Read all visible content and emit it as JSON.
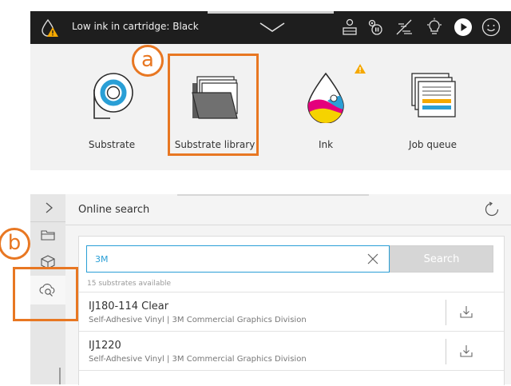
{
  "status_bar": {
    "message": "Low ink in cartridge: Black",
    "icons": [
      "ink-warning-icon",
      "chevron-down-icon",
      "substrate-load-icon",
      "cutter-icon",
      "lamp-icon",
      "light-icon",
      "play-icon",
      "smiley-icon"
    ]
  },
  "tiles": [
    {
      "label": "Substrate",
      "icon": "substrate-roll-icon"
    },
    {
      "label": "Substrate library",
      "icon": "folder-icon"
    },
    {
      "label": "Ink",
      "icon": "ink-drop-icon",
      "badge": "warning-icon"
    },
    {
      "label": "Job queue",
      "icon": "job-queue-icon"
    }
  ],
  "callouts": {
    "a": "a",
    "b": "b"
  },
  "colors": {
    "highlight": "#e87722",
    "accent": "#2a9fd6",
    "dark_bar": "#1e1e1e",
    "warning": "#f5a800"
  },
  "panel": {
    "title": "Online search",
    "search_value": "3M",
    "search_button": "Search",
    "result_count": "15 substrates available",
    "results": [
      {
        "name": "IJ180-114 Clear",
        "subtitle": "Self-Adhesive Vinyl | 3M Commercial Graphics Division"
      },
      {
        "name": "IJ1220",
        "subtitle": "Self-Adhesive Vinyl | 3M Commercial Graphics Division"
      }
    ]
  }
}
